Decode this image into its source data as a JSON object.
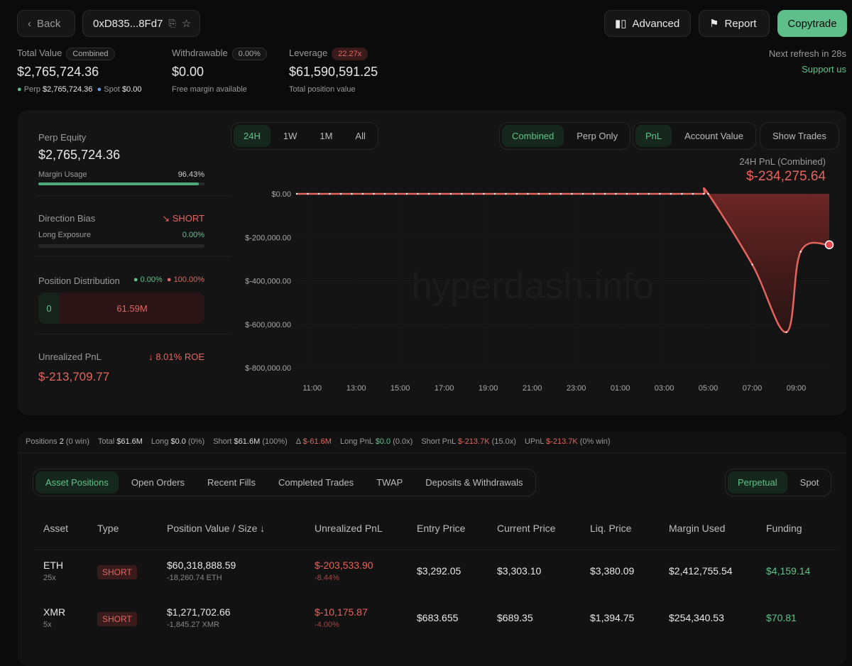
{
  "header": {
    "back": "Back",
    "address": "0xD835...8Fd7",
    "advanced": "Advanced",
    "report": "Report",
    "copytrade": "Copytrade",
    "next_refresh": "Next refresh in 28s",
    "support": "Support us"
  },
  "summary": {
    "total_value_label": "Total Value",
    "total_value_badge": "Combined",
    "total_value": "$2,765,724.36",
    "perp_label": "Perp",
    "perp_value": "$2,765,724.36",
    "spot_label": "Spot",
    "spot_value": "$0.00",
    "withdrawable_label": "Withdrawable",
    "withdrawable_badge": "0.00%",
    "withdrawable": "$0.00",
    "withdrawable_sub": "Free margin available",
    "leverage_label": "Leverage",
    "leverage_badge": "22.27x",
    "leverage_value": "$61,590,591.25",
    "leverage_sub": "Total position value"
  },
  "left": {
    "perp_equity_label": "Perp Equity",
    "perp_equity": "$2,765,724.36",
    "margin_usage_label": "Margin Usage",
    "margin_usage": "96.43%",
    "margin_usage_pct": 96.43,
    "direction_label": "Direction Bias",
    "direction": "SHORT",
    "long_exposure_label": "Long Exposure",
    "long_exposure": "0.00%",
    "long_exposure_pct": 0,
    "distribution_label": "Position Distribution",
    "dist_long": "0.00%",
    "dist_short": "100.00%",
    "dist_long_value": "0",
    "dist_short_value": "61.59M",
    "upnl_label": "Unrealized PnL",
    "roe": "8.01% ROE",
    "upnl": "$-213,709.77"
  },
  "chart_controls": {
    "ranges": [
      "24H",
      "1W",
      "1M",
      "All"
    ],
    "modes": [
      "Combined",
      "Perp Only"
    ],
    "metrics": [
      "PnL",
      "Account Value"
    ],
    "show_trades": "Show Trades"
  },
  "chart_data": {
    "type": "area",
    "title": "24H PnL (Combined)",
    "headline": "$-234,275.64",
    "xlabel": "",
    "ylabel": "",
    "ylim": [
      -800000,
      0
    ],
    "yticks": [
      0,
      -200000,
      -400000,
      -600000,
      -800000
    ],
    "ytick_labels": [
      "$0.00",
      "$-200,000.00",
      "$-400,000.00",
      "$-600,000.00",
      "$-800,000.00"
    ],
    "xtick_labels": [
      "11:00",
      "13:00",
      "15:00",
      "17:00",
      "19:00",
      "21:00",
      "23:00",
      "01:00",
      "03:00",
      "05:00",
      "07:00",
      "09:00"
    ],
    "x_unit": "hours since 11:00",
    "xlim": [
      -0.7,
      23.5
    ],
    "points": [
      [
        -0.7,
        0
      ],
      [
        -0.2,
        0
      ],
      [
        0.3,
        0
      ],
      [
        0.8,
        0
      ],
      [
        1.3,
        0
      ],
      [
        1.8,
        0
      ],
      [
        2.3,
        0
      ],
      [
        2.8,
        0
      ],
      [
        3.3,
        0
      ],
      [
        3.8,
        0
      ],
      [
        4.3,
        0
      ],
      [
        4.8,
        0
      ],
      [
        5.3,
        0
      ],
      [
        5.8,
        0
      ],
      [
        6.3,
        0
      ],
      [
        6.8,
        0
      ],
      [
        7.3,
        0
      ],
      [
        7.8,
        0
      ],
      [
        8.3,
        0
      ],
      [
        8.8,
        0
      ],
      [
        9.3,
        0
      ],
      [
        9.8,
        0
      ],
      [
        10.3,
        0
      ],
      [
        10.8,
        0
      ],
      [
        11.3,
        0
      ],
      [
        11.8,
        0
      ],
      [
        12.3,
        0
      ],
      [
        12.8,
        0
      ],
      [
        13.3,
        0
      ],
      [
        13.8,
        0
      ],
      [
        14.3,
        0
      ],
      [
        14.8,
        0
      ],
      [
        15.3,
        0
      ],
      [
        15.8,
        0
      ],
      [
        16.3,
        0
      ],
      [
        16.8,
        0
      ],
      [
        17.3,
        0
      ],
      [
        17.8,
        0
      ],
      [
        18.0,
        0
      ],
      [
        20.0,
        -325000
      ],
      [
        21.55,
        -636000
      ],
      [
        22.2,
        -266000
      ],
      [
        23.5,
        -234275.64
      ]
    ],
    "watermark": "hyperdash.info"
  },
  "stats": {
    "positions_label": "Positions",
    "positions": "2",
    "positions_sub": "(0 win)",
    "total_label": "Total",
    "total": "$61.6M",
    "long_label": "Long",
    "long": "$0.0",
    "long_sub": "(0%)",
    "short_label": "Short",
    "short": "$61.6M",
    "short_sub": "(100%)",
    "delta_label": "Δ",
    "delta": "$-61.6M",
    "long_pnl_label": "Long PnL",
    "long_pnl": "$0.0",
    "long_pnl_sub": "(0.0x)",
    "short_pnl_label": "Short PnL",
    "short_pnl": "$-213.7K",
    "short_pnl_sub": "(15.0x)",
    "upnl_label": "UPnL",
    "upnl": "$-213.7K",
    "upnl_sub": "(0% win)"
  },
  "tabs": [
    "Asset Positions",
    "Open Orders",
    "Recent Fills",
    "Completed Trades",
    "TWAP",
    "Deposits & Withdrawals"
  ],
  "market_tabs": [
    "Perpetual",
    "Spot"
  ],
  "table": {
    "headers": [
      "Asset",
      "Type",
      "Position Value / Size ↓",
      "Unrealized PnL",
      "Entry Price",
      "Current Price",
      "Liq. Price",
      "Margin Used",
      "Funding"
    ],
    "rows": [
      {
        "asset": "ETH",
        "lev": "25x",
        "type": "SHORT",
        "value": "$60,318,888.59",
        "size": "-18,260.74 ETH",
        "pnl": "$-203,533.90",
        "pnl_pct": "-8.44%",
        "entry": "$3,292.05",
        "current": "$3,303.10",
        "liq": "$3,380.09",
        "margin": "$2,412,755.54",
        "funding": "$4,159.14"
      },
      {
        "asset": "XMR",
        "lev": "5x",
        "type": "SHORT",
        "value": "$1,271,702.66",
        "size": "-1,845.27 XMR",
        "pnl": "$-10,175.87",
        "pnl_pct": "-4.00%",
        "entry": "$683.655",
        "current": "$689.35",
        "liq": "$1,394.75",
        "margin": "$254,340.53",
        "funding": "$70.81"
      }
    ]
  }
}
